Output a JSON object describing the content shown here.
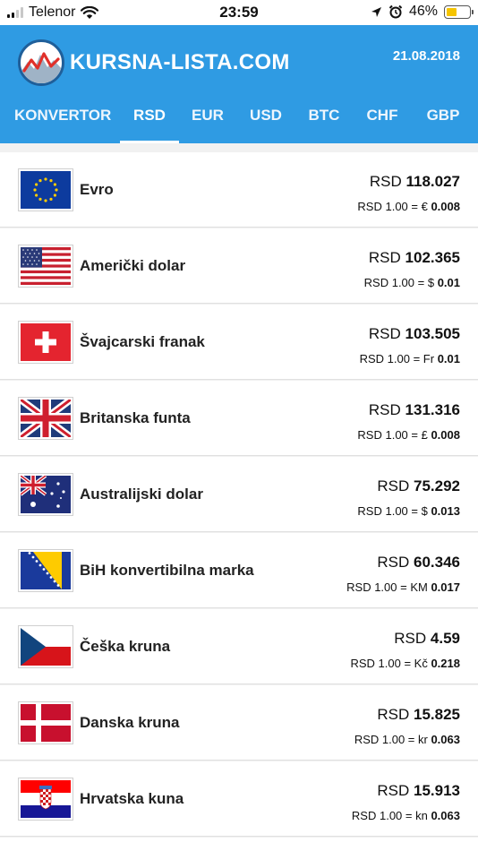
{
  "status_bar": {
    "carrier": "Telenor",
    "time": "23:59",
    "battery_percent": "46%",
    "battery_level": 0.46
  },
  "header": {
    "brand": "KURSNA-LISTA.COM",
    "date": "21.08.2018"
  },
  "tabs": [
    {
      "label": "KONVERTOR",
      "active": false
    },
    {
      "label": "RSD",
      "active": true
    },
    {
      "label": "EUR",
      "active": false
    },
    {
      "label": "USD",
      "active": false
    },
    {
      "label": "BTC",
      "active": false
    },
    {
      "label": "CHF",
      "active": false
    },
    {
      "label": "GBP",
      "active": false
    }
  ],
  "currencies": [
    {
      "name": "Evro",
      "flag": "eu-flag",
      "rate_prefix": "RSD",
      "rate": "118.027",
      "inverse_prefix": "RSD 1.00 = €",
      "inverse": "0.008"
    },
    {
      "name": "Američki dolar",
      "flag": "us-flag",
      "rate_prefix": "RSD",
      "rate": "102.365",
      "inverse_prefix": "RSD 1.00 = $",
      "inverse": "0.01"
    },
    {
      "name": "Švajcarski franak",
      "flag": "ch-flag",
      "rate_prefix": "RSD",
      "rate": "103.505",
      "inverse_prefix": "RSD 1.00 = Fr",
      "inverse": "0.01"
    },
    {
      "name": "Britanska funta",
      "flag": "gb-flag",
      "rate_prefix": "RSD",
      "rate": "131.316",
      "inverse_prefix": "RSD 1.00 = £",
      "inverse": "0.008"
    },
    {
      "name": "Australijski dolar",
      "flag": "au-flag",
      "rate_prefix": "RSD",
      "rate": "75.292",
      "inverse_prefix": "RSD 1.00 = $",
      "inverse": "0.013"
    },
    {
      "name": "BiH konvertibilna marka",
      "flag": "ba-flag",
      "rate_prefix": "RSD",
      "rate": "60.346",
      "inverse_prefix": "RSD 1.00 = KM",
      "inverse": "0.017"
    },
    {
      "name": "Češka kruna",
      "flag": "cz-flag",
      "rate_prefix": "RSD",
      "rate": "4.59",
      "inverse_prefix": "RSD 1.00 = Kč",
      "inverse": "0.218"
    },
    {
      "name": "Danska kruna",
      "flag": "dk-flag",
      "rate_prefix": "RSD",
      "rate": "15.825",
      "inverse_prefix": "RSD 1.00 = kr",
      "inverse": "0.063"
    },
    {
      "name": "Hrvatska kuna",
      "flag": "hr-flag",
      "rate_prefix": "RSD",
      "rate": "15.913",
      "inverse_prefix": "RSD 1.00 = kn",
      "inverse": "0.063"
    }
  ],
  "colors": {
    "header_blue": "#2f9be3",
    "background": "#f1f1f1",
    "battery_yellow": "#f5c400"
  }
}
